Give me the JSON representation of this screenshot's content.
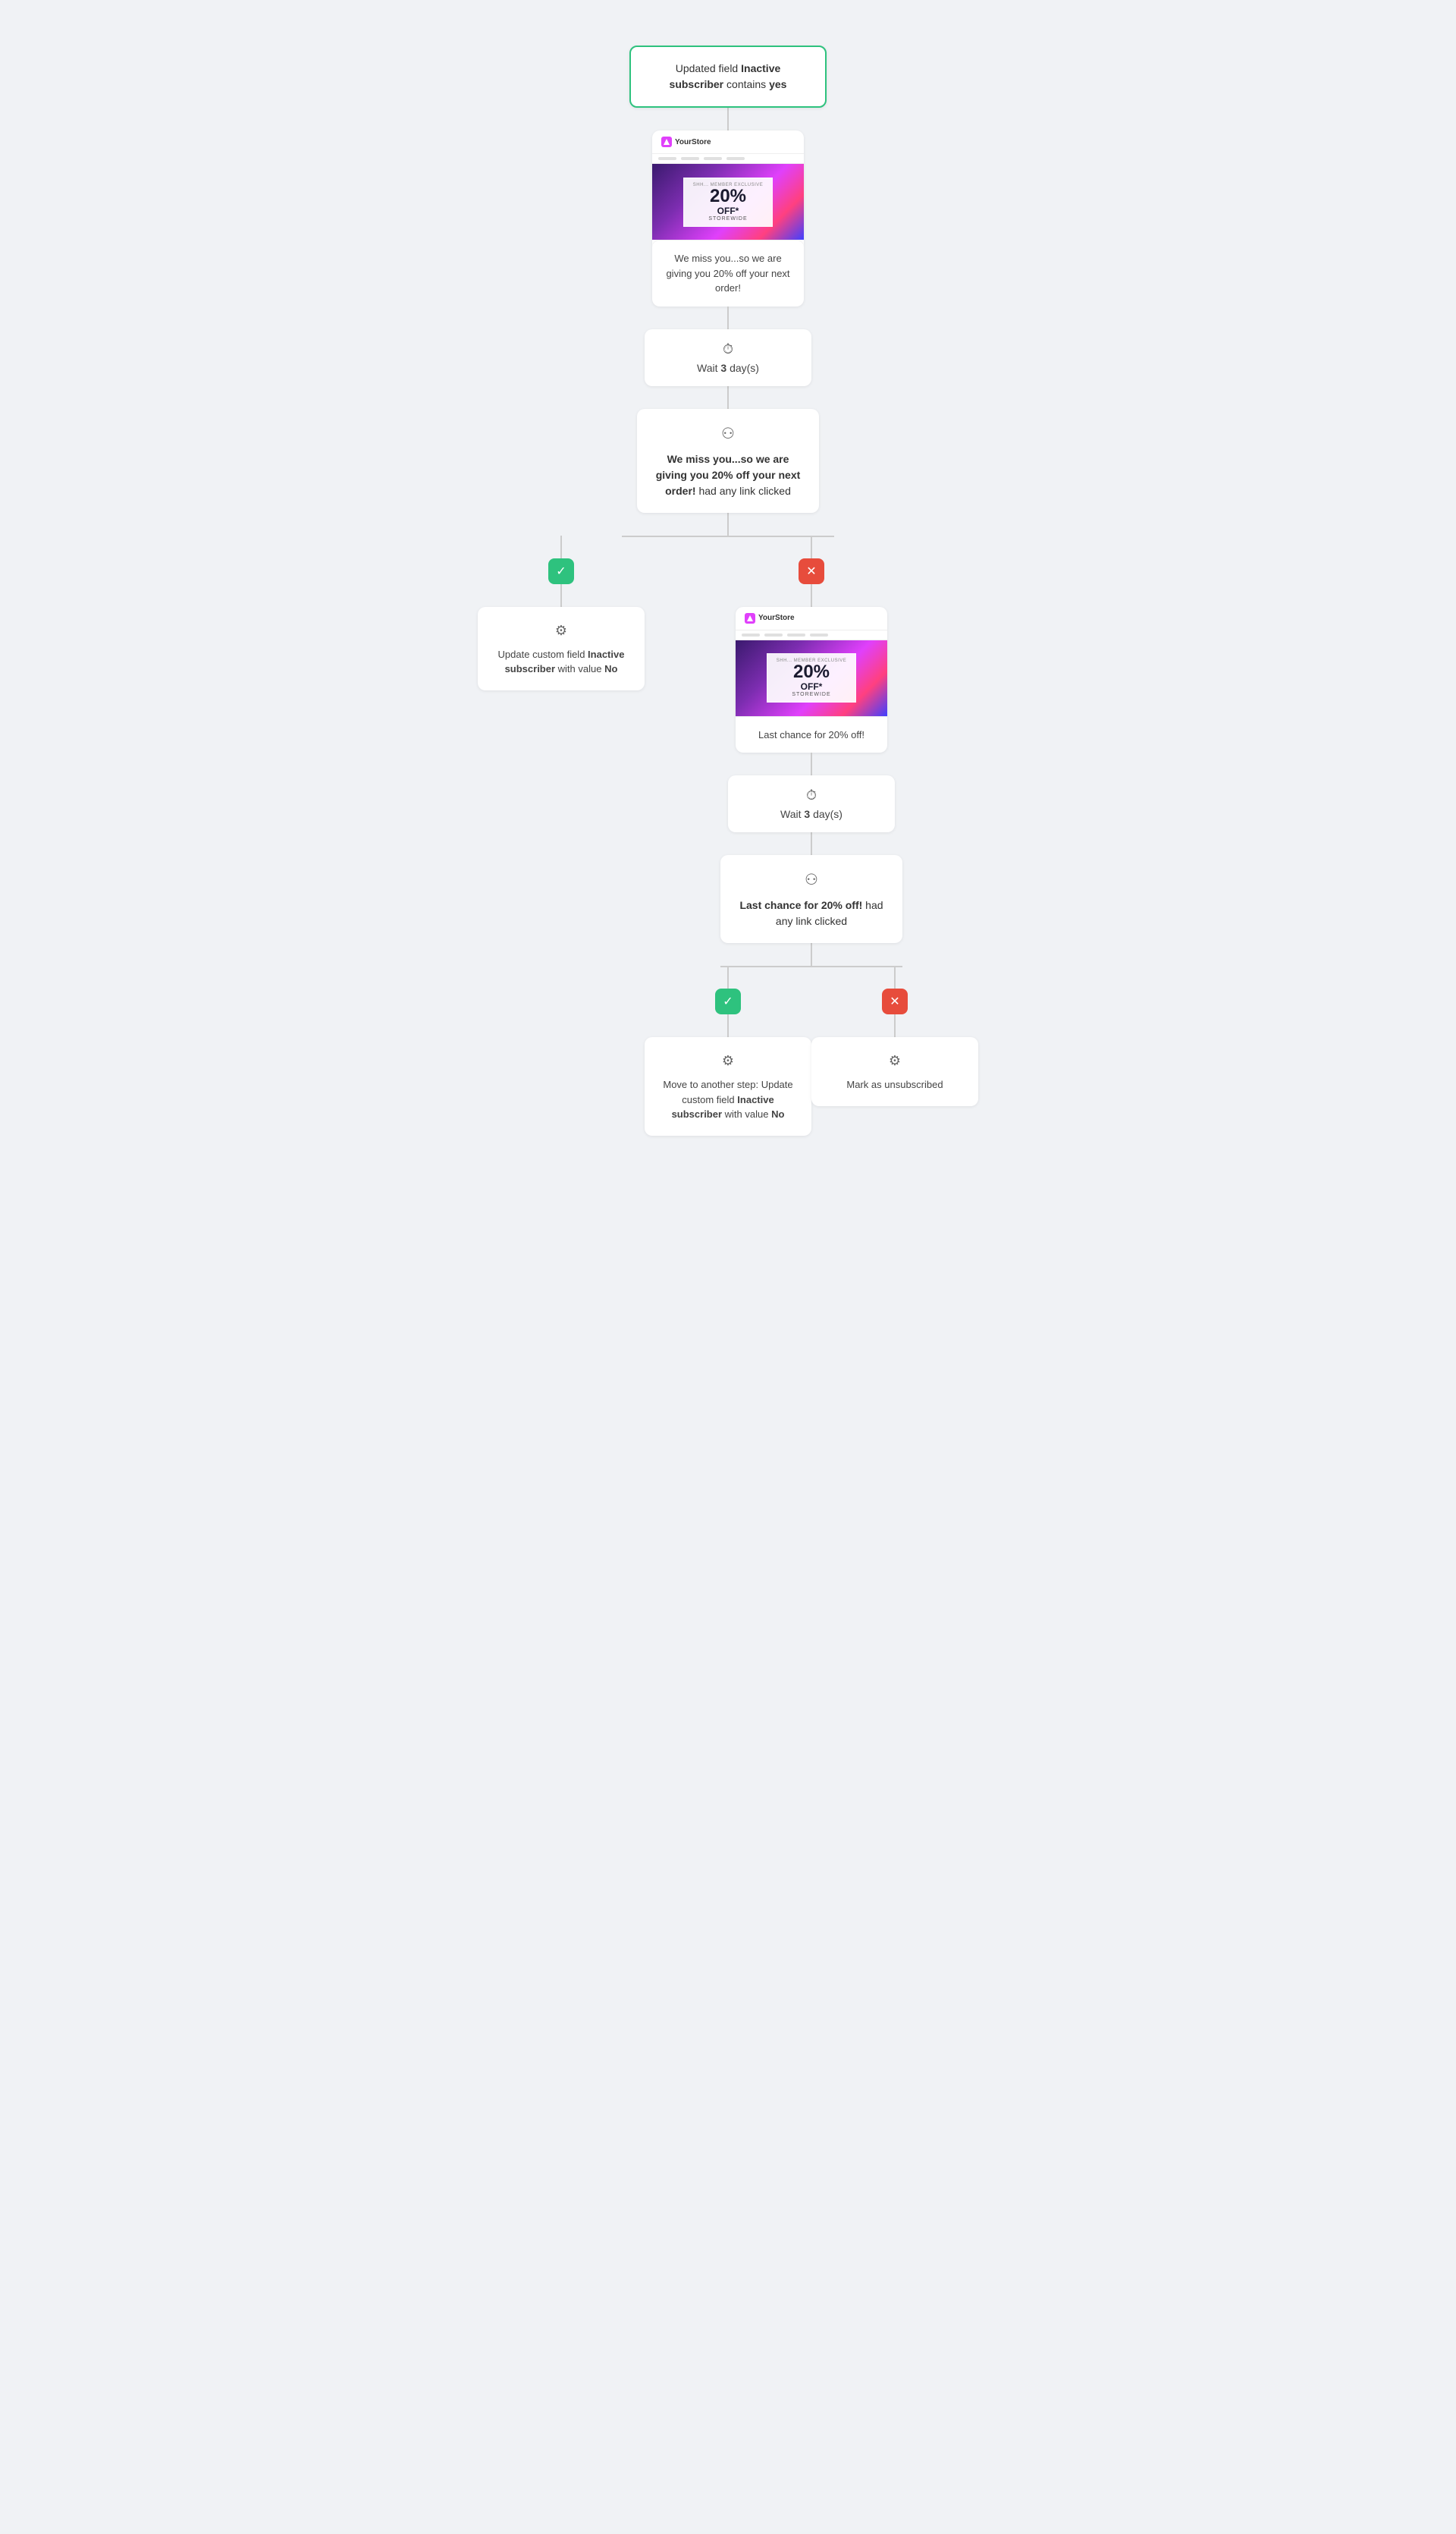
{
  "trigger": {
    "label_prefix": "Updated field ",
    "field_name": "Inactive subscriber",
    "label_mid": " contains ",
    "value": "yes"
  },
  "email1": {
    "brand": "YourStore",
    "promo_label": "SHH... MEMBER EXCLUSIVE",
    "promo_pct": "20%",
    "promo_off": "OFF*",
    "promo_store": "STOREWIDE",
    "caption": "We miss you...so we are giving you 20% off your next order!"
  },
  "wait1": {
    "icon": "⏱",
    "label_prefix": "Wait ",
    "days": "3",
    "label_suffix": " day(s)"
  },
  "branch1": {
    "icon": "⚇",
    "text_bold": "We miss you...so we are giving you 20% off your next order!",
    "text_rest": " had any link clicked"
  },
  "branch1_yes": {
    "badge": "✓",
    "action_icon": "⚙",
    "label": "Update custom field ",
    "field_bold": "Inactive subscriber",
    "label2": " with value ",
    "value_bold": "No"
  },
  "branch1_no": {
    "badge": "✕"
  },
  "email2": {
    "brand": "YourStore",
    "promo_label": "SHH... MEMBER EXCLUSIVE",
    "promo_pct": "20%",
    "promo_off": "OFF*",
    "promo_store": "STOREWIDE",
    "caption": "Last chance for 20% off!"
  },
  "wait2": {
    "icon": "⏱",
    "label_prefix": "Wait ",
    "days": "3",
    "label_suffix": " day(s)"
  },
  "branch2": {
    "icon": "⚇",
    "text_bold": "Last chance for 20% off!",
    "text_rest": " had any link clicked"
  },
  "branch2_yes": {
    "badge": "✓",
    "action_icon": "⚙",
    "label": "Move to another step: Update custom field ",
    "field_bold": "Inactive subscriber",
    "label2": " with value ",
    "value_bold": "No"
  },
  "branch2_no": {
    "badge": "✕",
    "action_icon": "⚙",
    "label": "Mark as unsubscribed"
  }
}
